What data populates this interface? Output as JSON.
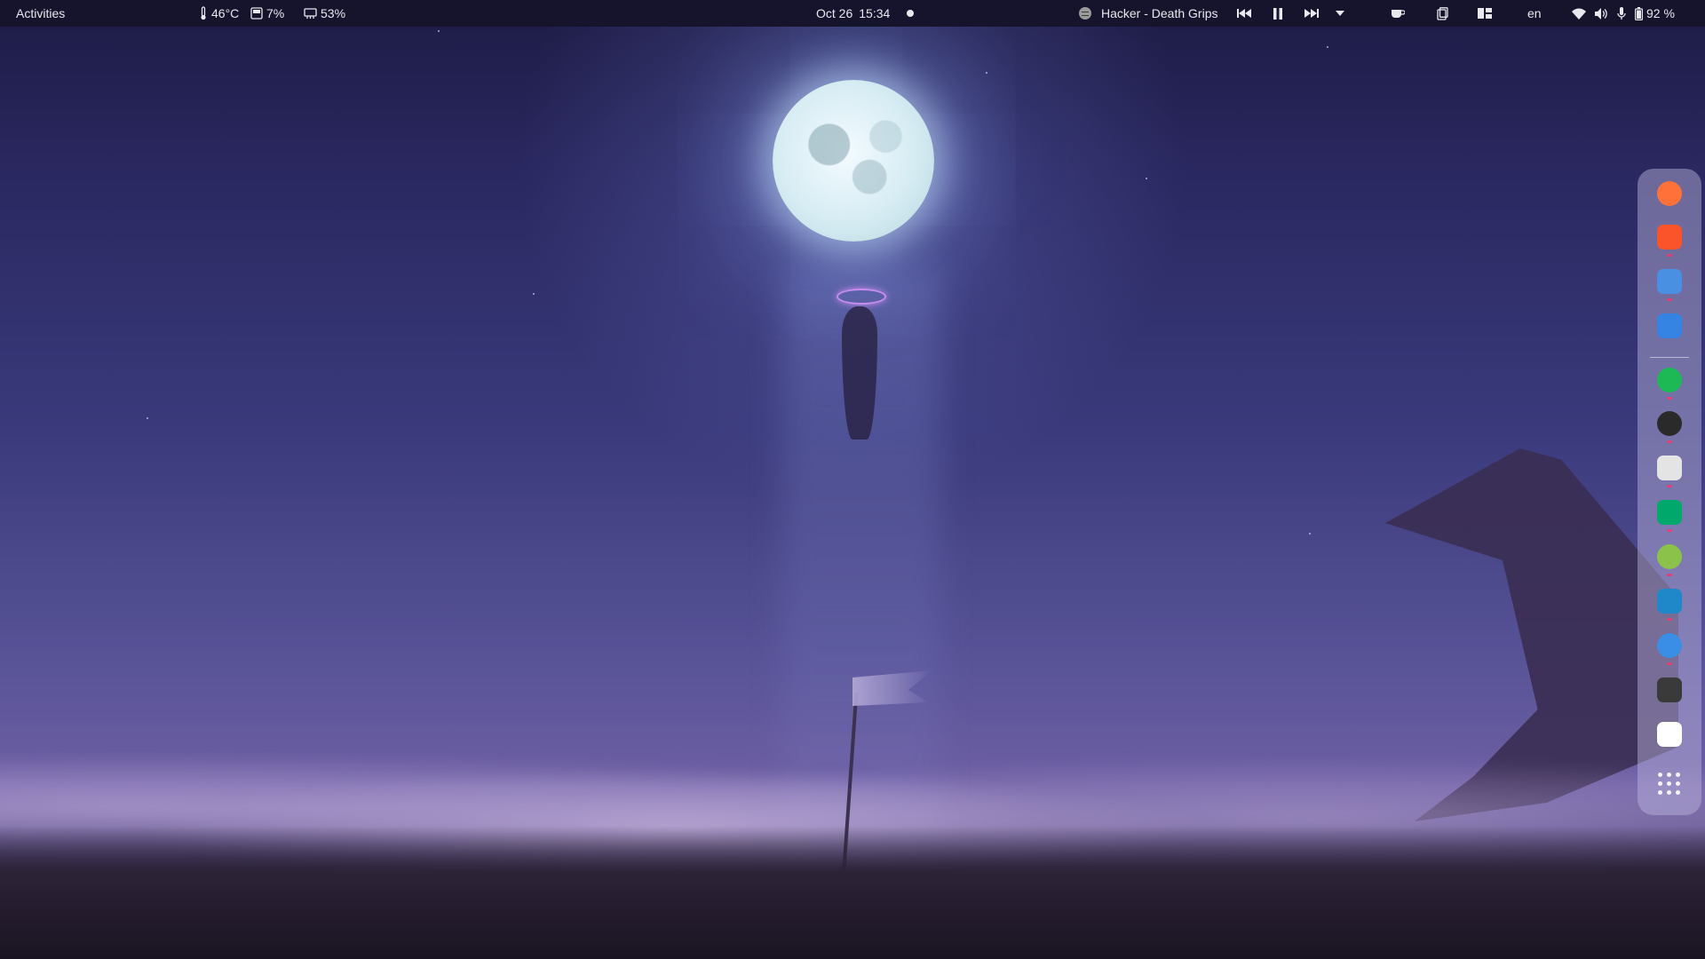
{
  "topbar": {
    "activities": "Activities",
    "temperature": "46°C",
    "disk": "7%",
    "memory": "53%",
    "date": "Oct 26",
    "time": "15:34",
    "now_playing": "Hacker - Death Grips",
    "keyboard_layout": "en",
    "battery": "92 %"
  },
  "dock": {
    "apps": [
      {
        "name": "firefox",
        "glyph": "",
        "color": "#ff7139",
        "running": false
      },
      {
        "name": "brave",
        "glyph": "",
        "color": "#fb542b",
        "running": true
      },
      {
        "name": "files",
        "glyph": "",
        "color": "#4a90e2",
        "running": true
      },
      {
        "name": "software",
        "glyph": "",
        "color": "#3584e4",
        "running": false
      },
      {
        "name": "spotify",
        "glyph": "",
        "color": "#1db954",
        "running": true
      },
      {
        "name": "arch-app",
        "glyph": "",
        "color": "#2a2a2a",
        "running": true
      },
      {
        "name": "calculator",
        "glyph": "",
        "color": "#e4e4e4",
        "running": true
      },
      {
        "name": "terminal-app",
        "glyph": "",
        "color": "#00a86b",
        "running": true
      },
      {
        "name": "extensions",
        "glyph": "",
        "color": "#8bc34a",
        "running": true
      },
      {
        "name": "settings",
        "glyph": "",
        "color": "#1e88c8",
        "running": true
      },
      {
        "name": "toggle-app",
        "glyph": "",
        "color": "#3a8ee6",
        "running": true
      },
      {
        "name": "archive",
        "glyph": "",
        "color": "#3a3a3a",
        "running": false
      },
      {
        "name": "trash",
        "glyph": "",
        "color": "#ffffff",
        "running": false
      }
    ]
  }
}
